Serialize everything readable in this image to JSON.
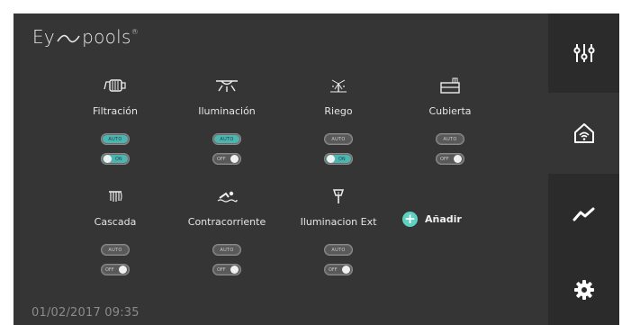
{
  "brand": {
    "text": "Ey",
    "text2": "pools",
    "reg": "®"
  },
  "devices": [
    {
      "id": "filtracion",
      "label": "Filtración",
      "icon": "pump-icon",
      "auto_label": "AUTO",
      "auto_active": true,
      "toggle_label": "ON",
      "toggle_on": true
    },
    {
      "id": "iluminacion",
      "label": "Iluminación",
      "icon": "light-icon",
      "auto_label": "AUTO",
      "auto_active": true,
      "toggle_label": "OFF",
      "toggle_on": false
    },
    {
      "id": "riego",
      "label": "Riego",
      "icon": "sprinkler-icon",
      "auto_label": "AUTO",
      "auto_active": false,
      "toggle_label": "ON",
      "toggle_on": true
    },
    {
      "id": "cubierta",
      "label": "Cubierta",
      "icon": "pool-cover-icon",
      "auto_label": "AUTO",
      "auto_active": false,
      "toggle_label": "OFF",
      "toggle_on": false
    },
    {
      "id": "cascada",
      "label": "Cascada",
      "icon": "waterfall-icon",
      "auto_label": "AUTO",
      "auto_active": false,
      "toggle_label": "OFF",
      "toggle_on": false
    },
    {
      "id": "contracorriente",
      "label": "Contracorriente",
      "icon": "swimmer-icon",
      "auto_label": "AUTO",
      "auto_active": false,
      "toggle_label": "OFF",
      "toggle_on": false
    },
    {
      "id": "iluminacion-ext",
      "label": "Iluminacion Ext",
      "icon": "garden-light-icon",
      "auto_label": "AUTO",
      "auto_active": false,
      "toggle_label": "OFF",
      "toggle_on": false
    }
  ],
  "add": {
    "label": "Añadir"
  },
  "status": {
    "datetime": "01/02/2017 09:35"
  },
  "sidebar": [
    {
      "icon": "sliders-icon",
      "active": false
    },
    {
      "icon": "home-wifi-icon",
      "active": true
    },
    {
      "icon": "trend-chart-icon",
      "active": false
    },
    {
      "icon": "gear-icon",
      "active": false
    }
  ],
  "colors": {
    "accent": "#4db5b0",
    "add": "#5ed1c3",
    "panel": "#353535",
    "sidebar": "#2b2b2b"
  }
}
